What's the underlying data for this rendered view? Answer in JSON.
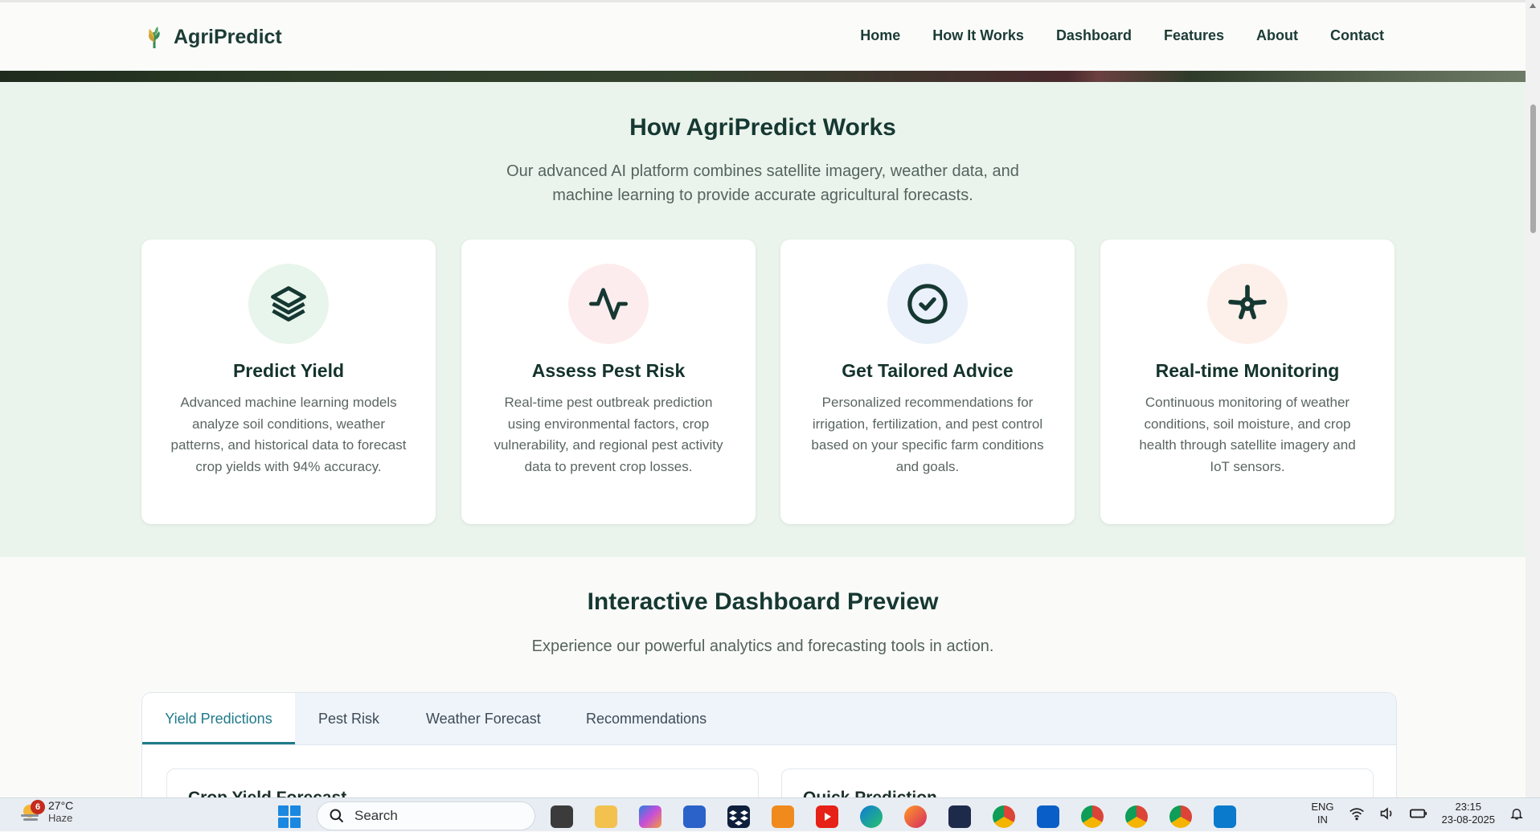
{
  "header": {
    "logo_text": "AgriPredict",
    "nav": [
      "Home",
      "How It Works",
      "Dashboard",
      "Features",
      "About",
      "Contact"
    ]
  },
  "how": {
    "title": "How AgriPredict Works",
    "subtitle": "Our advanced AI platform combines satellite imagery, weather data, and machine learning to provide accurate agricultural forecasts.",
    "cards": [
      {
        "icon": "layers-icon",
        "title": "Predict Yield",
        "text": "Advanced machine learning models analyze soil conditions, weather patterns, and historical data to forecast crop yields with 94% accuracy.",
        "bg": "#e8f5ec"
      },
      {
        "icon": "pulse-icon",
        "title": "Assess Pest Risk",
        "text": "Real-time pest outbreak prediction using environmental factors, crop vulnerability, and regional pest activity data to prevent crop losses.",
        "bg": "#fdecee"
      },
      {
        "icon": "check-circle-icon",
        "title": "Get Tailored Advice",
        "text": "Personalized recommendations for irrigation, fertilization, and pest control based on your specific farm conditions and goals.",
        "bg": "#eaf1fa"
      },
      {
        "icon": "satellite-icon",
        "title": "Real-time Monitoring",
        "text": "Continuous monitoring of weather conditions, soil moisture, and crop health through satellite imagery and IoT sensors.",
        "bg": "#fdf0ea"
      }
    ]
  },
  "dashboard": {
    "title": "Interactive Dashboard Preview",
    "subtitle": "Experience our powerful analytics and forecasting tools in action.",
    "tabs": [
      "Yield Predictions",
      "Pest Risk",
      "Weather Forecast",
      "Recommendations"
    ],
    "active_tab": "Yield Predictions",
    "left_card_title": "Crop Yield Forecast",
    "right_card_title": "Quick Prediction"
  },
  "taskbar": {
    "weather_badge": "6",
    "temperature": "27°C",
    "condition": "Haze",
    "search_placeholder": "Search",
    "lang_top": "ENG",
    "lang_bottom": "IN",
    "time": "23:15",
    "date": "23-08-2025"
  }
}
